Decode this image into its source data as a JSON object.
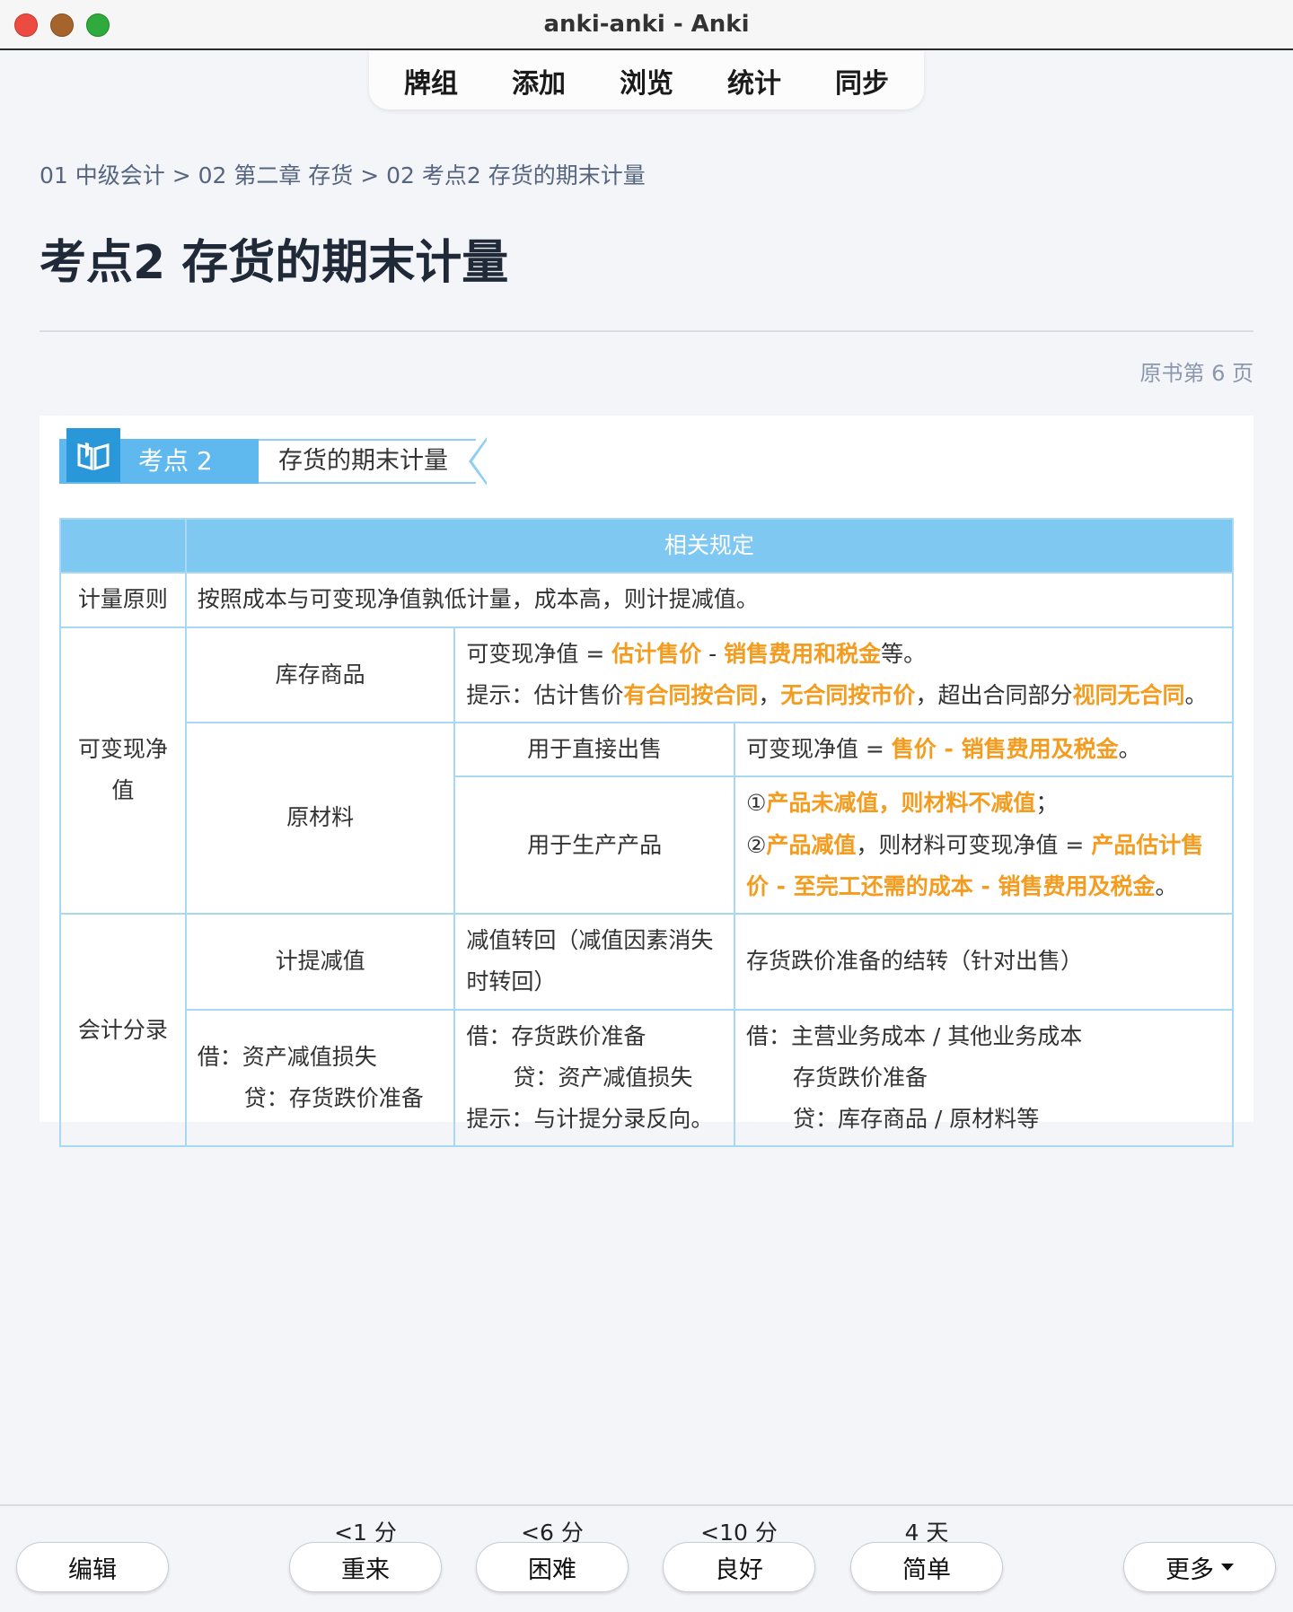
{
  "window": {
    "title": "anki-anki - Anki"
  },
  "nav": {
    "decks": "牌组",
    "add": "添加",
    "browse": "浏览",
    "stats": "统计",
    "sync": "同步"
  },
  "breadcrumb": "01 中级会计 > 02 第二章 存货 > 02 考点2 存货的期末计量",
  "page_title": "考点2 存货的期末计量",
  "page_ref": "原书第 6 页",
  "book": {
    "tag": "考点 2",
    "name": "存货的期末计量",
    "table_header": "相关规定",
    "row1": {
      "label": "计量原则",
      "text": "按照成本与可变现净值孰低计量，成本高，则计提减值。"
    },
    "nrv": {
      "label": "可变现净值",
      "goods": {
        "label": "库存商品",
        "l1_a": "可变现净值 = ",
        "l1_b": "估计售价",
        "l1_c": " - ",
        "l1_d": "销售费用和税金",
        "l1_e": "等。",
        "l2_a": "提示：估计售价",
        "l2_b": "有合同按合同",
        "l2_c": "，",
        "l2_d": "无合同按市价",
        "l2_e": "，超出合同部分",
        "l2_f": "视同无合同",
        "l2_g": "。"
      },
      "material": {
        "label": "原材料",
        "direct_label": "用于直接出售",
        "direct_a": "可变现净值 = ",
        "direct_b": "售价 - 销售费用及税金",
        "direct_c": "。",
        "prod_label": "用于生产产品",
        "p1_a": "①",
        "p1_b": "产品未减值，则材料不减值",
        "p1_c": "；",
        "p2_a": "②",
        "p2_b": "产品减值",
        "p2_c": "，则材料可变现净值 = ",
        "p2_d": "产品估计售价 - 至完工还需的成本 - 销售费用及税金",
        "p2_e": "。"
      }
    },
    "entries": {
      "label": "会计分录",
      "provision_label": "计提减值",
      "reversal_label": "减值转回（减值因素消失时转回）",
      "transfer_label": "存货跌价准备的结转（针对出售）",
      "provision_l1": "借：资产减值损失",
      "provision_l2": "贷：存货跌价准备",
      "reversal_l1": "借：存货跌价准备",
      "reversal_l2": "贷：资产减值损失",
      "reversal_l3": "提示：与计提分录反向。",
      "transfer_l1": "借：主营业务成本 / 其他业务成本",
      "transfer_l2": "存货跌价准备",
      "transfer_l3": "贷：库存商品 / 原材料等"
    }
  },
  "answer": {
    "edit": "编辑",
    "again": "重来",
    "again_ivl": "<1 分",
    "hard": "困难",
    "hard_ivl": "<6 分",
    "good": "良好",
    "good_ivl": "<10 分",
    "easy": "简单",
    "easy_ivl": "4 天",
    "more": "更多"
  },
  "colors": {
    "accent": "#7fc8f1",
    "highlight": "#f39c1f"
  }
}
